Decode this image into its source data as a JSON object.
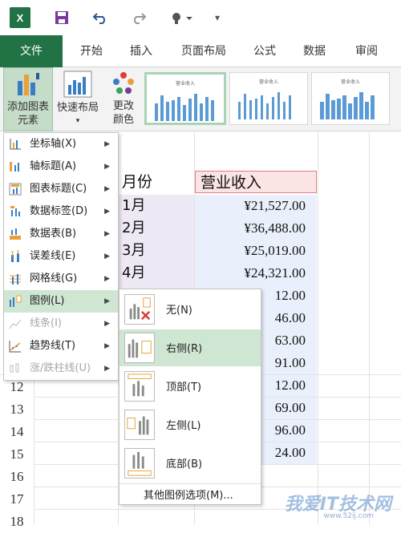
{
  "title_bar": {
    "excel_label": "X",
    "save_icon": "save-icon",
    "undo_icon": "undo-icon",
    "redo_icon": "redo-icon",
    "touch_icon": "touch-mode-icon",
    "more": "▾"
  },
  "tabs": [
    {
      "label": "文件"
    },
    {
      "label": "开始"
    },
    {
      "label": "插入"
    },
    {
      "label": "页面布局"
    },
    {
      "label": "公式"
    },
    {
      "label": "数据"
    },
    {
      "label": "审阅"
    }
  ],
  "ribbon": {
    "add_chart_element": "添加图表",
    "add_chart_element_2": "元素",
    "quick_layout": "快速布局",
    "change_colors": "更改",
    "change_colors_2": "颜色",
    "style_thumb_1": "营业收入",
    "style_thumb_2": "营业收入",
    "style_thumb_3": "营业收入"
  },
  "sheet": {
    "header_month": "月份",
    "header_income": "营业收入",
    "months": [
      "1月",
      "2月",
      "3月",
      "4月"
    ],
    "incomes": [
      "¥21,527.00",
      "¥36,488.00",
      "¥25,019.00",
      "¥24,321.00",
      "12.00",
      "46.00",
      "63.00",
      "91.00",
      "12.00",
      "69.00",
      "96.00",
      "24.00"
    ],
    "row_numbers": [
      "12",
      "13",
      "14",
      "15",
      "16",
      "17",
      "18"
    ]
  },
  "chart_menu": [
    {
      "label": "坐标轴(X)",
      "icon": "axes-icon"
    },
    {
      "label": "轴标题(A)",
      "icon": "axis-title-icon"
    },
    {
      "label": "图表标题(C)",
      "icon": "chart-title-icon"
    },
    {
      "label": "数据标签(D)",
      "icon": "data-labels-icon"
    },
    {
      "label": "数据表(B)",
      "icon": "data-table-icon"
    },
    {
      "label": "误差线(E)",
      "icon": "error-bars-icon"
    },
    {
      "label": "网格线(G)",
      "icon": "gridlines-icon"
    },
    {
      "label": "图例(L)",
      "icon": "legend-icon"
    },
    {
      "label": "线条(I)",
      "icon": "lines-icon"
    },
    {
      "label": "趋势线(T)",
      "icon": "trendline-icon"
    },
    {
      "label": "涨/跌柱线(U)",
      "icon": "up-down-bars-icon"
    }
  ],
  "legend_submenu": [
    {
      "label": "无(N)",
      "icon": "legend-none-icon"
    },
    {
      "label": "右侧(R)",
      "icon": "legend-right-icon"
    },
    {
      "label": "顶部(T)",
      "icon": "legend-top-icon"
    },
    {
      "label": "左侧(L)",
      "icon": "legend-left-icon"
    },
    {
      "label": "底部(B)",
      "icon": "legend-bottom-icon"
    }
  ],
  "more_legend_options": "其他图例选项(M)...",
  "watermark": "我爱IT技术网",
  "watermark_url": "www.52ij.com"
}
